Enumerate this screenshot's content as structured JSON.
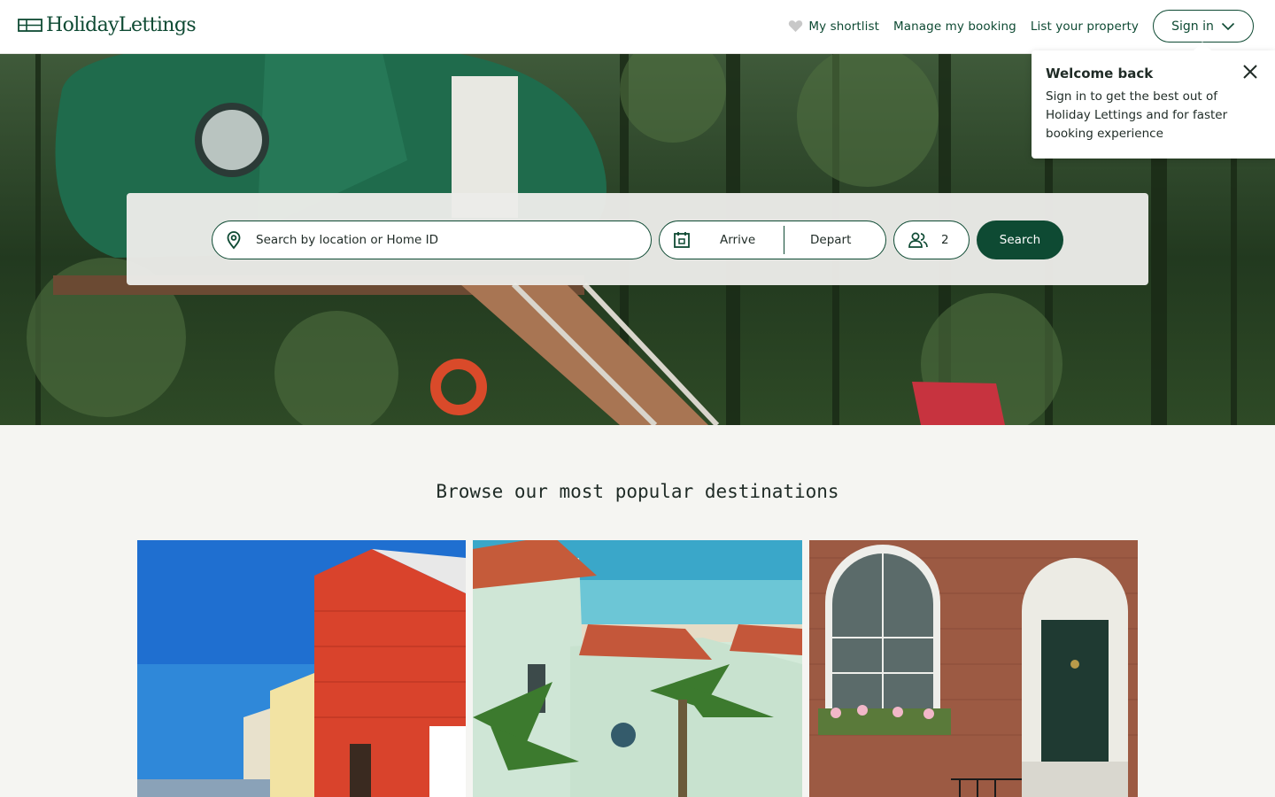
{
  "brand": {
    "name": "HolidayLettings",
    "color": "#0e4a33"
  },
  "nav": {
    "shortlist": "My shortlist",
    "manage_booking": "Manage my booking",
    "list_property": "List your property",
    "sign_in": "Sign in"
  },
  "search": {
    "location_placeholder": "Search by location or Home ID",
    "arrive": "Arrive",
    "depart": "Depart",
    "guests": "2",
    "button": "Search"
  },
  "popover": {
    "title": "Welcome back",
    "text": "Sign in to get the best out of Holiday Lettings and for faster booking experience"
  },
  "browse": {
    "title": "Browse our most popular destinations"
  },
  "icons": [
    "logo-icon",
    "heart-icon",
    "chevron-down-icon",
    "location-pin-icon",
    "calendar-icon",
    "guests-icon",
    "close-icon"
  ]
}
